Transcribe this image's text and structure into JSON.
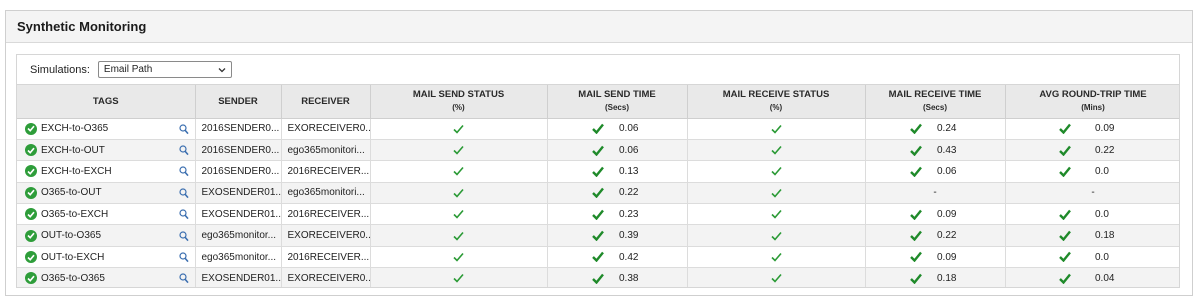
{
  "panel": {
    "title": "Synthetic Monitoring"
  },
  "toolbar": {
    "simulations_label": "Simulations:",
    "simulations_value": "Email Path"
  },
  "columns": {
    "tags": "TAGS",
    "sender": "SENDER",
    "receiver": "RECEIVER",
    "send_status": "MAIL SEND STATUS",
    "send_status_unit": "(%)",
    "send_time": "MAIL SEND TIME",
    "send_time_unit": "(Secs)",
    "receive_status": "MAIL RECEIVE STATUS",
    "receive_status_unit": "(%)",
    "receive_time": "MAIL RECEIVE TIME",
    "receive_time_unit": "(Secs)",
    "round_trip": "AVG ROUND-TRIP TIME",
    "round_trip_unit": "(Mins)"
  },
  "rows": [
    {
      "tag": "EXCH-to-O365",
      "sender": "2016SENDER0...",
      "receiver": "EXORECEIVER0...",
      "send_time": "0.06",
      "receive_time": "0.24",
      "round_trip": "0.09"
    },
    {
      "tag": "EXCH-to-OUT",
      "sender": "2016SENDER0...",
      "receiver": "ego365monitori...",
      "send_time": "0.06",
      "receive_time": "0.43",
      "round_trip": "0.22"
    },
    {
      "tag": "EXCH-to-EXCH",
      "sender": "2016SENDER0...",
      "receiver": "2016RECEIVER...",
      "send_time": "0.13",
      "receive_time": "0.06",
      "round_trip": "0.0"
    },
    {
      "tag": "O365-to-OUT",
      "sender": "EXOSENDER01...",
      "receiver": "ego365monitori...",
      "send_time": "0.22",
      "receive_time": "-",
      "round_trip": "-"
    },
    {
      "tag": "O365-to-EXCH",
      "sender": "EXOSENDER01...",
      "receiver": "2016RECEIVER...",
      "send_time": "0.23",
      "receive_time": "0.09",
      "round_trip": "0.0"
    },
    {
      "tag": "OUT-to-O365",
      "sender": "ego365monitor...",
      "receiver": "EXORECEIVER0...",
      "send_time": "0.39",
      "receive_time": "0.22",
      "round_trip": "0.18"
    },
    {
      "tag": "OUT-to-EXCH",
      "sender": "ego365monitor...",
      "receiver": "2016RECEIVER...",
      "send_time": "0.42",
      "receive_time": "0.09",
      "round_trip": "0.0"
    },
    {
      "tag": "O365-to-O365",
      "sender": "EXOSENDER01...",
      "receiver": "EXORECEIVER0...",
      "send_time": "0.38",
      "receive_time": "0.18",
      "round_trip": "0.04"
    }
  ],
  "colors": {
    "status_green": "#2e9d3a",
    "check_green": "#1f8a2a",
    "header_bg": "#e9e9e9"
  },
  "icons": {
    "status": "check-circle-icon",
    "drilldown": "search-icon",
    "ok": "checkmark-icon",
    "dropdown": "chevron-down-icon"
  }
}
